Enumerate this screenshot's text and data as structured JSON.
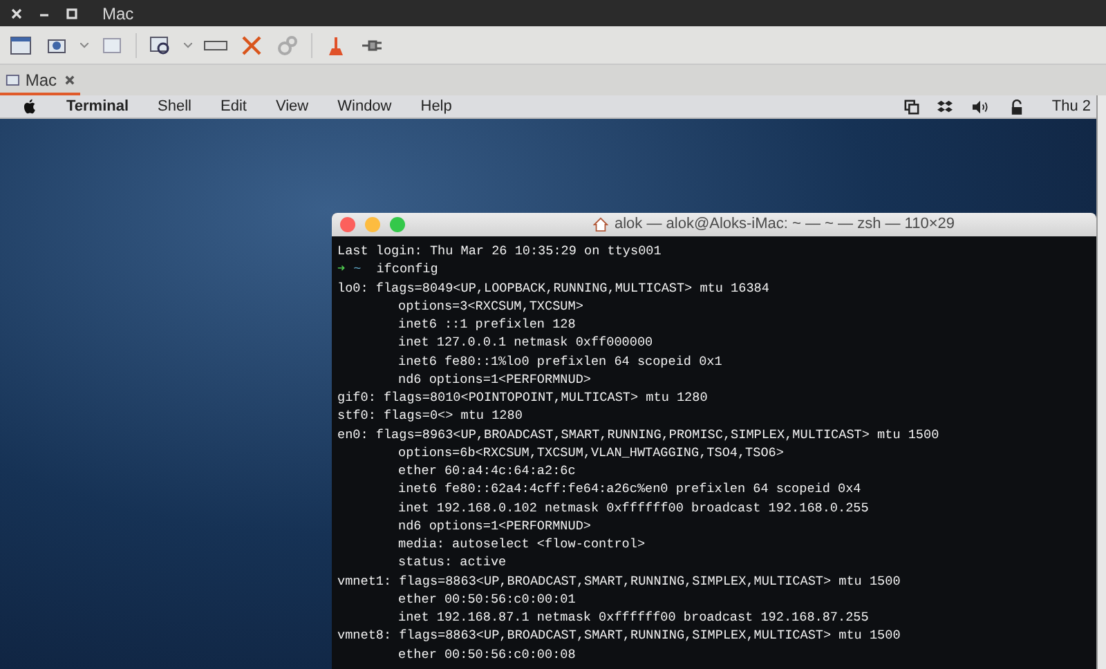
{
  "window": {
    "title": "Mac"
  },
  "tabs": [
    {
      "label": "Mac",
      "selected": true
    }
  ],
  "menu_bar": {
    "items": [
      {
        "label": "Terminal",
        "bold": true
      },
      {
        "label": "Shell",
        "bold": false
      },
      {
        "label": "Edit",
        "bold": false
      },
      {
        "label": "View",
        "bold": false
      },
      {
        "label": "Window",
        "bold": false
      },
      {
        "label": "Help",
        "bold": false
      }
    ],
    "clock": "Thu 2"
  },
  "terminal": {
    "title": "alok — alok@Aloks-iMac: ~ — ~ — zsh — 110×29",
    "lines": [
      {
        "kind": "text",
        "text": "Last login: Thu Mar 26 10:35:29 on ttys001"
      },
      {
        "kind": "prompt",
        "arrow": "➜",
        "cwd": "~",
        "command": "ifconfig"
      },
      {
        "kind": "block",
        "text": "lo0: flags=8049<UP,LOOPBACK,RUNNING,MULTICAST> mtu 16384",
        "children": [
          "options=3<RXCSUM,TXCSUM>",
          "inet6 ::1 prefixlen 128",
          "inet 127.0.0.1 netmask 0xff000000",
          "inet6 fe80::1%lo0 prefixlen 64 scopeid 0x1",
          "nd6 options=1<PERFORMNUD>"
        ]
      },
      {
        "kind": "block",
        "text": "gif0: flags=8010<POINTOPOINT,MULTICAST> mtu 1280"
      },
      {
        "kind": "block",
        "text": "stf0: flags=0<> mtu 1280"
      },
      {
        "kind": "block",
        "text": "en0: flags=8963<UP,BROADCAST,SMART,RUNNING,PROMISC,SIMPLEX,MULTICAST> mtu 1500",
        "children": [
          "options=6b<RXCSUM,TXCSUM,VLAN_HWTAGGING,TSO4,TSO6>",
          "ether 60:a4:4c:64:a2:6c",
          "inet6 fe80::62a4:4cff:fe64:a26c%en0 prefixlen 64 scopeid 0x4",
          "inet 192.168.0.102 netmask 0xffffff00 broadcast 192.168.0.255",
          "nd6 options=1<PERFORMNUD>",
          "media: autoselect <flow-control>",
          "status: active"
        ]
      },
      {
        "kind": "block",
        "text": "vmnet1: flags=8863<UP,BROADCAST,SMART,RUNNING,SIMPLEX,MULTICAST> mtu 1500",
        "children": [
          "ether 00:50:56:c0:00:01",
          "inet 192.168.87.1 netmask 0xffffff00 broadcast 192.168.87.255"
        ]
      },
      {
        "kind": "block",
        "text": "vmnet8: flags=8863<UP,BROADCAST,SMART,RUNNING,SIMPLEX,MULTICAST> mtu 1500",
        "children": [
          "ether 00:50:56:c0:00:08"
        ]
      }
    ]
  }
}
